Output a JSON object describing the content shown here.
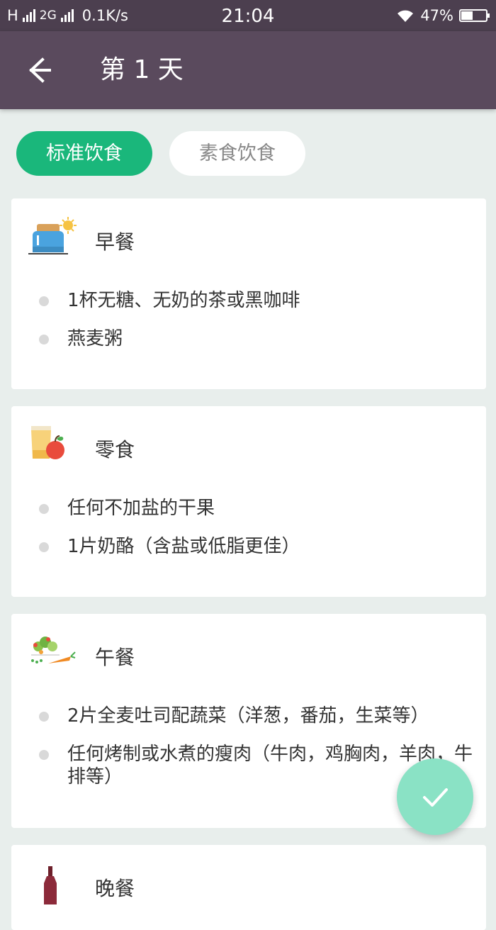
{
  "status_bar": {
    "carrier1": "H",
    "carrier2": "2G",
    "speed": "0.1K/s",
    "time": "21:04",
    "battery": "47%",
    "battery_level": 0.47
  },
  "toolbar": {
    "title": "第 1 天"
  },
  "tabs": [
    {
      "label": "标准饮食",
      "active": true
    },
    {
      "label": "素食饮食",
      "active": false
    }
  ],
  "meals": [
    {
      "name": "早餐",
      "icon": "toaster-icon",
      "items": [
        "1杯无糖、无奶的茶或黑咖啡",
        "燕麦粥"
      ]
    },
    {
      "name": "零食",
      "icon": "juice-apple-icon",
      "items": [
        "任何不加盐的干果",
        "1片奶酪（含盐或低脂更佳）"
      ]
    },
    {
      "name": "午餐",
      "icon": "vegetables-icon",
      "items": [
        "2片全麦吐司配蔬菜（洋葱，番茄，生菜等）",
        "任何烤制或水煮的瘦肉（牛肉，鸡胸肉，羊肉，牛排等）"
      ]
    },
    {
      "name": "晚餐",
      "icon": "wine-bottle-icon",
      "items": []
    }
  ],
  "colors": {
    "accent": "#1ab77b",
    "fab": "#8ae2c5",
    "toolbar": "#5a4a5d",
    "statusbar": "#4c3f4f"
  }
}
